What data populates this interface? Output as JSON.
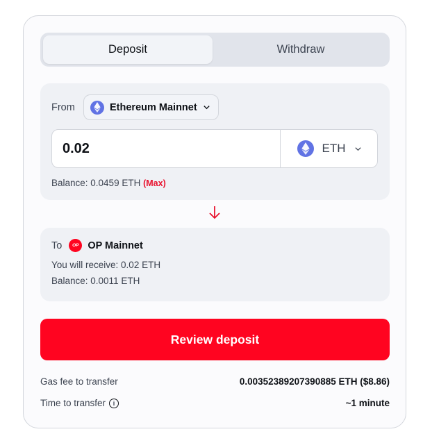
{
  "tabs": [
    {
      "label": "Deposit",
      "active": true
    },
    {
      "label": "Withdraw",
      "active": false
    }
  ],
  "from": {
    "label": "From",
    "network": "Ethereum Mainnet",
    "network_icon": "ethereum-icon",
    "amount": "0.02",
    "token": "ETH",
    "balance_label": "Balance: 0.0459 ETH",
    "max_label": "(Max)"
  },
  "to": {
    "label": "To",
    "network": "OP Mainnet",
    "network_icon": "op-icon",
    "icon_text": "OP",
    "receive_text": "You will receive: 0.02 ETH",
    "balance_text": "Balance: 0.0011 ETH"
  },
  "review_button": "Review deposit",
  "gas_fee": {
    "label": "Gas fee to transfer",
    "value": "0.00352389207390885 ETH ($8.86)"
  },
  "time": {
    "label": "Time to transfer",
    "value": "~1 minute"
  },
  "colors": {
    "accent": "#ff0420",
    "ethereum": "#6173e4",
    "panel": "#eff1f5"
  }
}
